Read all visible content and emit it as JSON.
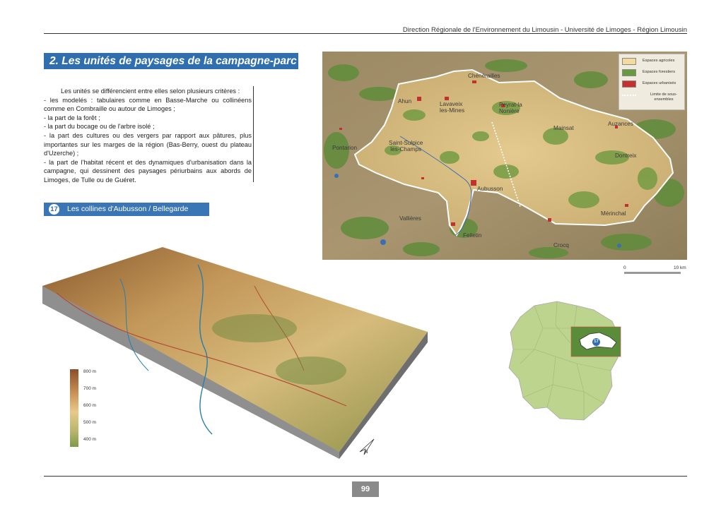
{
  "header": {
    "institution_text": "Direction Régionale de l'Environnement du Limousin - Université de Limoges - Région Limousin"
  },
  "section": {
    "title": "2. Les unités de paysages de la campagne-parc"
  },
  "intro": {
    "lead": "Les unités se différencient entre elles selon plusieurs critères :",
    "criteria": [
      "- les modelés : tabulaires comme en Basse-Marche ou collinéens comme en Combraille ou autour de Limoges ;",
      "- la part de la forêt ;",
      "- la part du bocage ou de l'arbre isolé ;",
      "- la part des cultures ou des vergers par rapport aux pâtures, plus importantes sur les marges de la région (Bas-Berry, ouest du plateau d'Uzerche) ;",
      "- la part de l'habitat récent et des dynamiques d'urbanisation dans la campagne, qui dessinent des paysages périurbains aux abords de Limoges, de Tulle ou de Guéret."
    ]
  },
  "unit": {
    "number": "17",
    "name": "Les collines d'Aubusson / Bellegarde"
  },
  "map": {
    "places": {
      "chenerailles": "Chénérailles",
      "ahun": "Ahun",
      "lavaveix": "Lavaveix\nles-Mines",
      "peyrat": "Peyrat-la\nNonière",
      "mainsat": "Mainsat",
      "auzances": "Auzances",
      "pontarion": "Pontarion",
      "saint_sulpice": "Saint-Sulpice\nles-Champs",
      "dontreix": "Dontreix",
      "aubusson": "Aubusson",
      "vallieres": "Vallières",
      "felletin": "Felletin",
      "merinchal": "Mérinchal",
      "crocq": "Crocq"
    },
    "legend": [
      {
        "label": "Espaces agricoles",
        "color": "#f3dc9b"
      },
      {
        "label": "Espaces forestiers",
        "color": "#6a9a3e"
      },
      {
        "label": "Espaces urbanisés",
        "color": "#c83030"
      },
      {
        "label": "Limite de sous-ensembles",
        "color": "#ffffff"
      }
    ],
    "scale": {
      "start": "0",
      "end": "10 km"
    }
  },
  "elevation_scale": [
    "800 m",
    "700 m",
    "600 m",
    "500 m",
    "400 m"
  ],
  "locator": {
    "badge": "17"
  },
  "page": {
    "number": "99"
  },
  "colors": {
    "title_blue": "#2f6faf",
    "subtitle_blue": "#3a76b5",
    "page_badge_gray": "#8a8a8a",
    "region_green": "#bcd48e",
    "unit_box_green": "#5a8c3a"
  }
}
